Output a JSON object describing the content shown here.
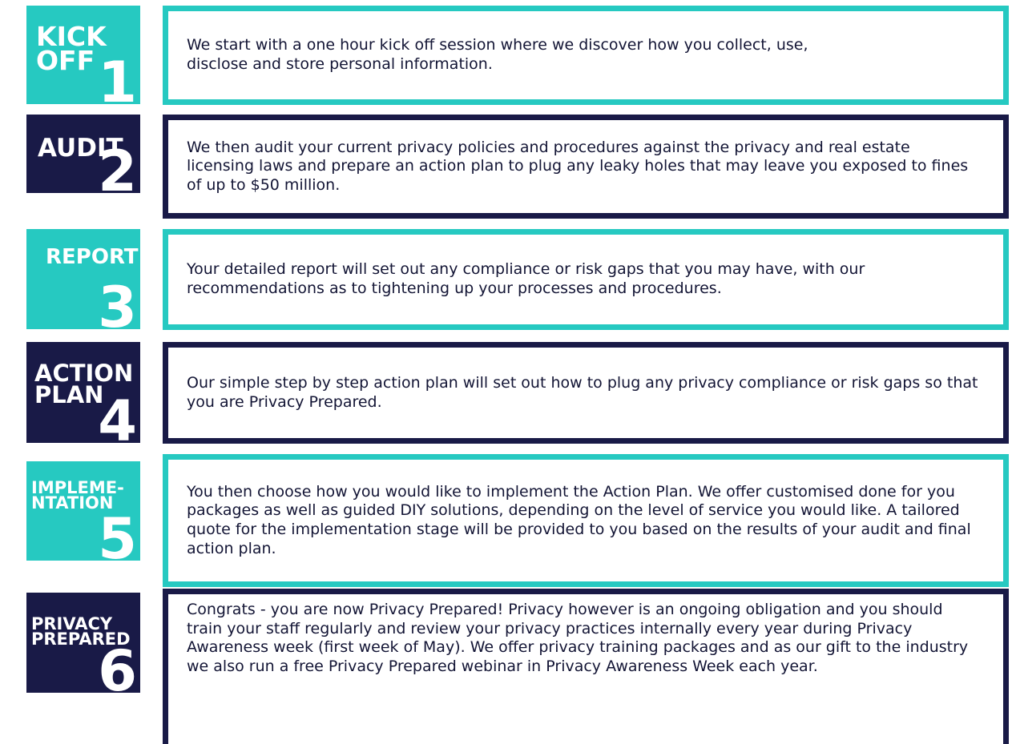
{
  "colors": {
    "teal": "#26c9c1",
    "navy": "#191a47",
    "text": "#131535"
  },
  "steps": [
    {
      "label": "KICK\nOFF",
      "number": "1",
      "text": "We start with a one hour kick off session where we discover how you collect, use, disclose and store personal information."
    },
    {
      "label": "AUDIT",
      "number": "2",
      "text": "We then audit your current privacy policies and procedures against the privacy and real estate licensing laws and prepare an action plan to plug any leaky holes that may leave you exposed to fines of up to $50 million."
    },
    {
      "label": "REPORT",
      "number": "3",
      "text": "Your detailed report will set out any compliance or risk gaps that you may have, with our recommendations as to tightening up your processes and procedures."
    },
    {
      "label": "ACTION\nPLAN",
      "number": "4",
      "text": "Our simple step by step action plan will set out how to plug any privacy compliance or risk gaps so that you are Privacy Prepared."
    },
    {
      "label": "IMPLEME-\nNTATION",
      "number": "5",
      "text": "You then choose how you would like to implement the Action Plan. We offer customised done for you packages as well as guided DIY solutions, depending on the level of service you would like. A tailored quote for the implementation stage will be provided to you based on the results of your audit and final action plan."
    },
    {
      "label": "PRIVACY\nPREPARED",
      "number": "6",
      "text": "Congrats - you are now Privacy Prepared! Privacy however is an ongoing obligation and you should train your staff regularly and review your privacy practices internally every year during Privacy Awareness week (first week of May). We offer privacy training packages and as our gift to the industry we also run a free Privacy Prepared webinar in Privacy Awareness Week each year."
    }
  ]
}
